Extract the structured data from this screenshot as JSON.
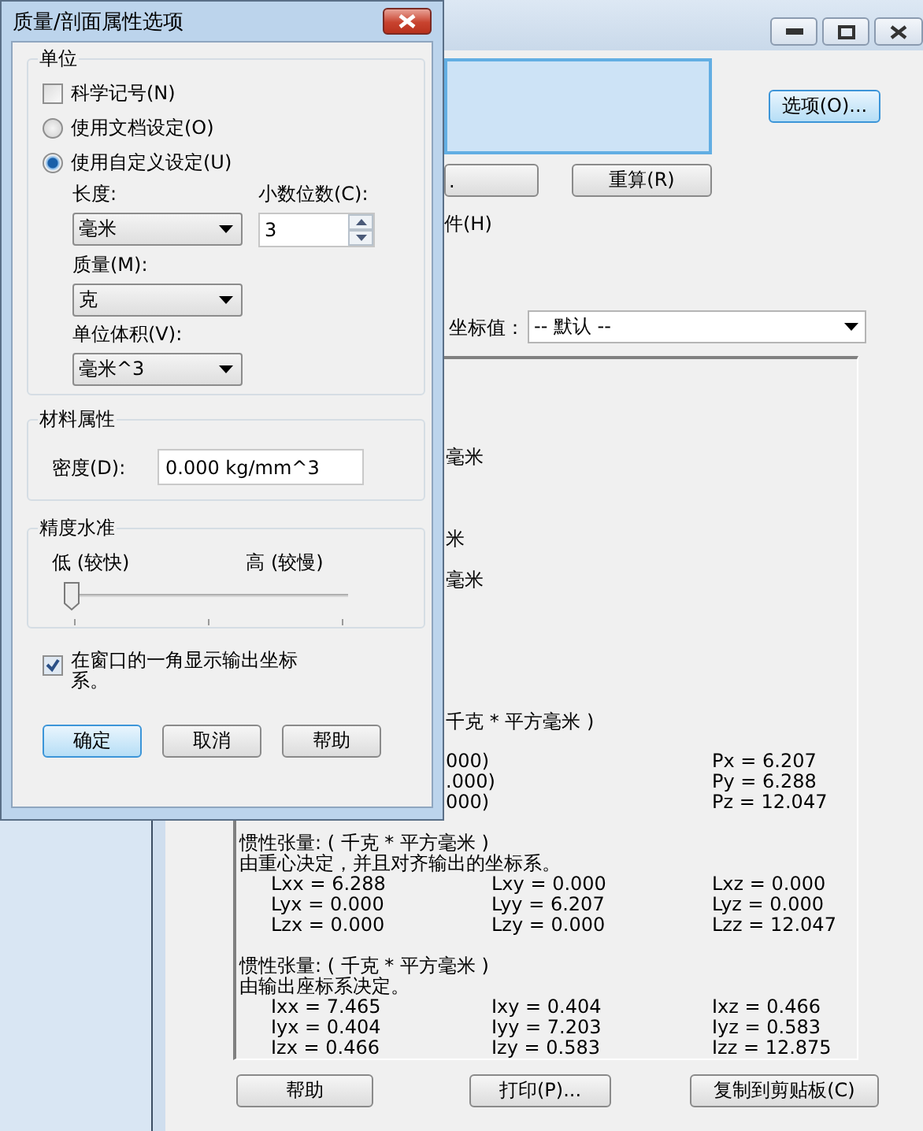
{
  "options_dialog": {
    "title": "质量/剖面属性选项",
    "units": {
      "title": "单位",
      "scientific": {
        "label": "科学记号(N)",
        "checked": false
      },
      "sources": [
        {
          "label": "使用文档设定(O)",
          "selected": false
        },
        {
          "label": "使用自定义设定(U)",
          "selected": true
        }
      ],
      "length": {
        "label": "长度:",
        "value": "毫米"
      },
      "decimals": {
        "label": "小数位数(C):",
        "value": "3"
      },
      "mass": {
        "label": "质量(M):",
        "value": "克"
      },
      "volume": {
        "label": "单位体积(V):",
        "value": "毫米^3"
      }
    },
    "material": {
      "title": "材料属性",
      "density": {
        "label": "密度(D):",
        "value": "0.000 kg/mm^3"
      }
    },
    "accuracy": {
      "title": "精度水准",
      "low_label": "低 (较快)",
      "high_label": "高 (较慢)",
      "level": 0
    },
    "show_axes": {
      "label": "在窗口的一角显示输出坐标系。",
      "checked": true
    },
    "buttons": [
      {
        "label": "确定",
        "default": true
      },
      {
        "label": "取消",
        "default": false
      },
      {
        "label": "帮助",
        "default": false
      }
    ]
  },
  "main_window": {
    "options_button": "选项(O)...",
    "buttons": [
      ".",
      "重算(R)"
    ],
    "checkbox_fragment": "件(H)",
    "coordinate_label": "坐标值：",
    "coordinate_select": "-- 默认 --",
    "results": [
      {
        "kind": "blank"
      },
      {
        "kind": "blank"
      },
      {
        "kind": "blank"
      },
      {
        "kind": "blank"
      },
      {
        "kind": "fragment",
        "text": "毫米"
      },
      {
        "kind": "blank"
      },
      {
        "kind": "blank"
      },
      {
        "kind": "blank"
      },
      {
        "kind": "fragment",
        "text": "米"
      },
      {
        "kind": "blank"
      },
      {
        "kind": "fragment",
        "text": "毫米"
      },
      {
        "kind": "blank"
      },
      {
        "kind": "blank"
      },
      {
        "kind": "blank"
      },
      {
        "kind": "blank"
      },
      {
        "kind": "blank"
      },
      {
        "kind": "blank"
      },
      {
        "kind": "fragment",
        "text": "千克 * 平方毫米 )"
      },
      {
        "kind": "blank"
      },
      {
        "kind": "fragment_values",
        "fragment": "000)",
        "value": "Px = 6.207"
      },
      {
        "kind": "fragment_values",
        "fragment": ".000)",
        "value": "Py = 6.288"
      },
      {
        "kind": "fragment_values",
        "fragment": "000)",
        "value": "Pz = 12.047"
      },
      {
        "kind": "blank"
      },
      {
        "kind": "text",
        "text": "惯性张量: ( 千克 * 平方毫米 )"
      },
      {
        "kind": "text",
        "text": "由重心决定，并且对齐输出的坐标系。"
      },
      {
        "kind": "values",
        "cells": [
          "Lxx = 6.288",
          "Lxy = 0.000",
          "Lxz = 0.000"
        ]
      },
      {
        "kind": "values",
        "cells": [
          "Lyx = 0.000",
          "Lyy = 6.207",
          "Lyz = 0.000"
        ]
      },
      {
        "kind": "values",
        "cells": [
          "Lzx = 0.000",
          "Lzy = 0.000",
          "Lzz = 12.047"
        ]
      },
      {
        "kind": "blank"
      },
      {
        "kind": "text",
        "text": "惯性张量: ( 千克 * 平方毫米 )"
      },
      {
        "kind": "text",
        "text": "由输出座标系决定。"
      },
      {
        "kind": "values",
        "cells": [
          "Ixx = 7.465",
          "Ixy = 0.404",
          "Ixz = 0.466"
        ]
      },
      {
        "kind": "values",
        "cells": [
          "Iyx = 0.404",
          "Iyy = 7.203",
          "Iyz = 0.583"
        ]
      },
      {
        "kind": "values",
        "cells": [
          "Izx = 0.466",
          "Izy = 0.583",
          "Izz = 12.875"
        ]
      }
    ],
    "bottom_buttons": [
      "帮助",
      "打印(P)...",
      "复制到剪贴板(C)"
    ]
  }
}
